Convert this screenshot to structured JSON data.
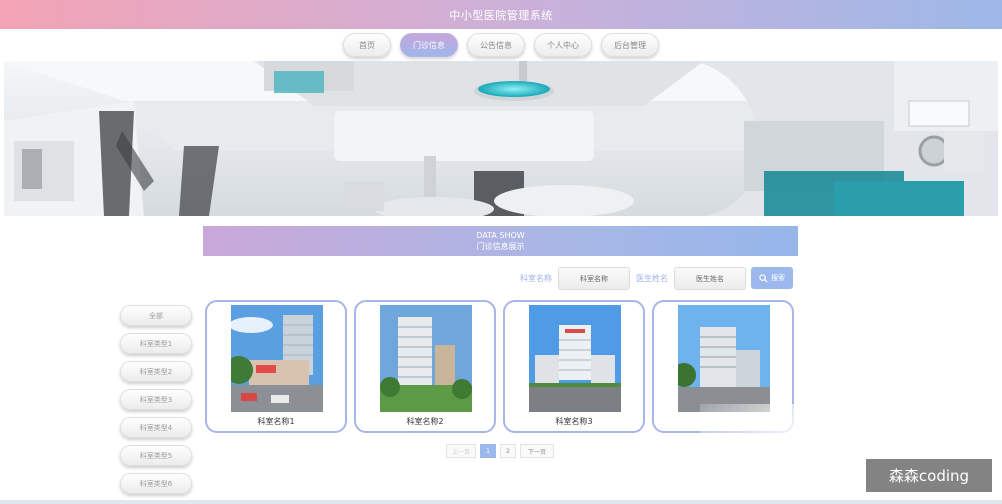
{
  "header": {
    "title": "中小型医院管理系统"
  },
  "nav": [
    {
      "label": "首页",
      "active": false
    },
    {
      "label": "门诊信息",
      "active": true
    },
    {
      "label": "公告信息",
      "active": false
    },
    {
      "label": "个人中心",
      "active": false
    },
    {
      "label": "后台管理",
      "active": false
    }
  ],
  "section": {
    "title_en": "DATA SHOW",
    "title_cn": "门诊信息展示"
  },
  "search": {
    "dept_label": "科室名称",
    "dept_placeholder": "科室名称",
    "doctor_label": "医生姓名",
    "doctor_placeholder": "医生姓名",
    "button_label": "搜索"
  },
  "sidebar": [
    {
      "label": "全部"
    },
    {
      "label": "科室类型1"
    },
    {
      "label": "科室类型2"
    },
    {
      "label": "科室类型3"
    },
    {
      "label": "科室类型4"
    },
    {
      "label": "科室类型5"
    },
    {
      "label": "科室类型6"
    }
  ],
  "cards": [
    {
      "name": "科室名称1"
    },
    {
      "name": "科室名称2"
    },
    {
      "name": "科室名称3"
    },
    {
      "name": ""
    }
  ],
  "pagination": {
    "prev": "上一页",
    "pages": [
      "1",
      "2"
    ],
    "current": "1",
    "next": "下一页"
  },
  "watermark": "森森coding",
  "colors": {
    "accent": "#9db8ec",
    "pink": "#f3a3b4",
    "purple": "#c9a8d8"
  }
}
